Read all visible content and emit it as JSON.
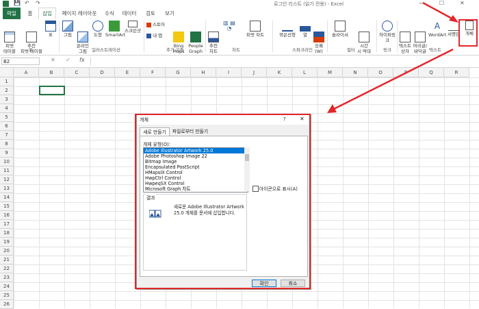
{
  "titlebar": {
    "title": "로그인 리스트 (읽기 전용) - Excel"
  },
  "tabs": [
    {
      "label": "파일"
    },
    {
      "label": "홈"
    },
    {
      "label": "삽입"
    },
    {
      "label": "페이지 레이아웃"
    },
    {
      "label": "수식"
    },
    {
      "label": "데이터"
    },
    {
      "label": "검토"
    },
    {
      "label": "보기"
    }
  ],
  "ribbon": {
    "pivot": "피벗\n테이블",
    "rec_pivot": "추천\n피벗 테이블",
    "table": "표",
    "group_table": "표",
    "picture": "그림",
    "online_picture": "온라인\n그림",
    "shapes": "도형",
    "smartart": "SmartArt",
    "screenshot": "스크린샷",
    "group_illust": "일러스트레이션",
    "store": "스토어",
    "my_addins": "내 앱",
    "bing": "Bing\nMaps",
    "people": "People\nGraph",
    "group_addins": "추가 기능",
    "rec_chart": "추천\n차트",
    "pivot_chart": "피벗 차트",
    "group_chart": "차트",
    "spark_line": "꺾은선형",
    "spark_col": "열",
    "spark_wl": "승패\n(W)",
    "group_spark": "스파크라인",
    "slicer": "슬라이서",
    "timeline": "시간\n시 막대",
    "group_filter": "필터",
    "hyperlink": "하이퍼링크",
    "group_link": "링크",
    "textbox": "텍스트\n상자",
    "header": "머리글/\n바닥글",
    "wordart": "WordArt",
    "signature": "서명란",
    "object": "개체",
    "group_text": "텍스트"
  },
  "formula": {
    "namebox": "B2",
    "fx": "fx"
  },
  "columns": [
    "A",
    "B",
    "C",
    "D",
    "E",
    "F",
    "G",
    "H",
    "I",
    "J",
    "K",
    "L",
    "M",
    "N",
    "O",
    "P",
    "Q",
    "R"
  ],
  "rows": [
    "1",
    "2",
    "3",
    "4",
    "5",
    "6",
    "7",
    "8",
    "9",
    "10",
    "11",
    "12",
    "13",
    "14",
    "15",
    "16",
    "17",
    "18",
    "19",
    "20",
    "21",
    "22",
    "23",
    "24",
    "25",
    "26"
  ],
  "dialog": {
    "title": "개체",
    "help": "?",
    "close": "✕",
    "tab_new": "새로 만들기",
    "tab_file": "파일로부터 만들기",
    "type_label": "개체 유형(O):",
    "types": [
      "Adobe Illustrator Artwork 25.0",
      "Adobe Photoshop Image 22",
      "Bitmap Image",
      "Encapsulated PostScript",
      "HMapsIX Control",
      "HwpCtrl Control",
      "HwpeqSX Control",
      "Microsoft Graph 차트"
    ],
    "selected_index": 0,
    "show_as_icon": "아이콘으로 표시(A)",
    "result_label": "결과",
    "result_text": "새로운 Adobe Illustrator Artwork 25.0 개체를 문서에 삽입합니다.",
    "ok": "확인",
    "cancel": "취소"
  },
  "colors": {
    "excel_green": "#217346",
    "highlight_red": "#e3262a",
    "selection_blue": "#0078d7"
  }
}
